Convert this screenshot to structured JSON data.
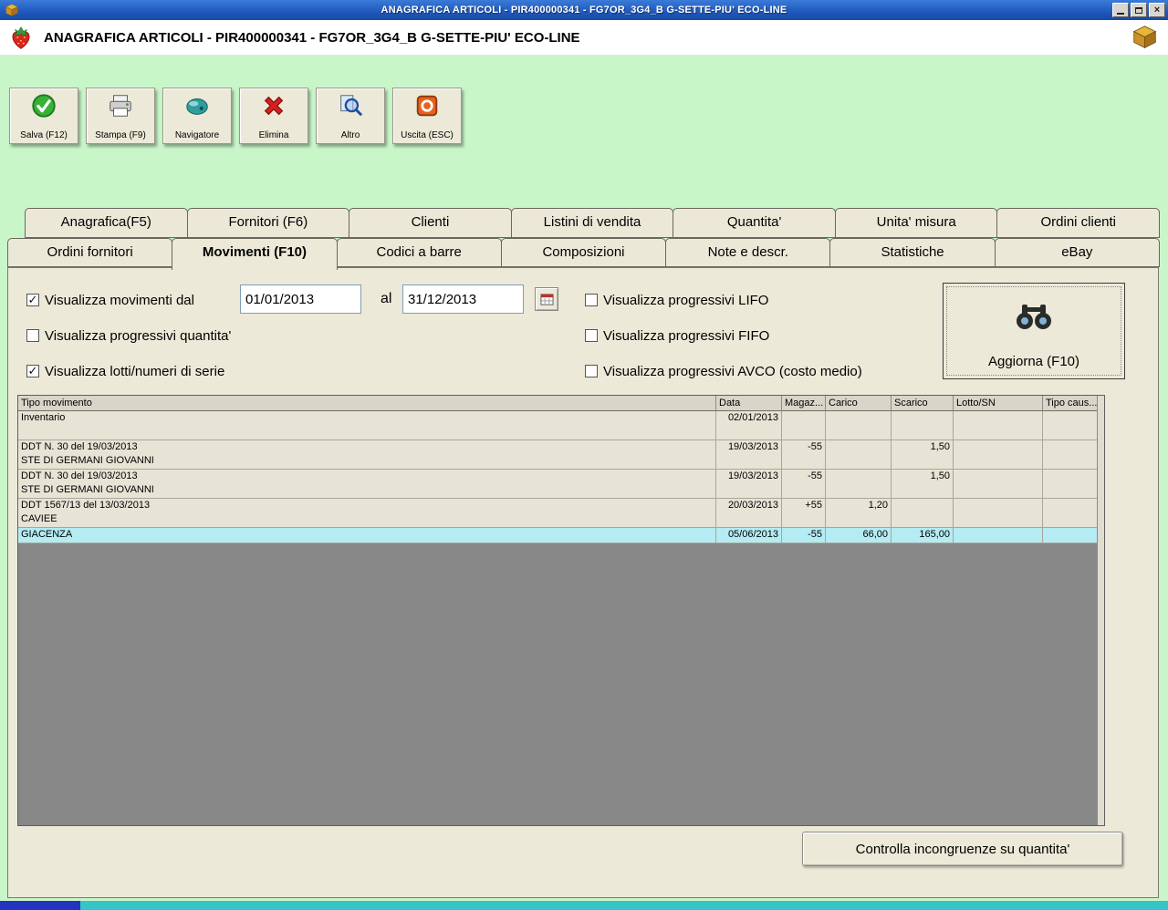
{
  "colors": {
    "background_green": "#c9f6c9",
    "panel": "#ece9d8",
    "highlight_row": "#b5ebf2",
    "titlebar_blue": "#1f58bc",
    "grid_empty_area": "#878787",
    "taskbar_teal": "#35c4c8"
  },
  "icons": {
    "app": "strawberry-icon",
    "package": "box-icon",
    "save": "green-check-circle-icon",
    "print": "printer-icon",
    "navigator": "mouse-icon",
    "delete": "red-x-icon",
    "other": "magnifier-icon",
    "exit": "power-icon",
    "refresh": "binoculars-icon",
    "calendar": "calendar-icon"
  },
  "titlebar": {
    "title": "ANAGRAFICA ARTICOLI - PIR400000341 - FG7OR_3G4_B G-SETTE-PIU' ECO-LINE"
  },
  "header": {
    "title": "ANAGRAFICA ARTICOLI - PIR400000341 - FG7OR_3G4_B G-SETTE-PIU' ECO-LINE"
  },
  "toolbar": {
    "salva": "Salva (F12)",
    "stampa": "Stampa (F9)",
    "navigatore": "Navigatore",
    "elimina": "Elimina",
    "altro": "Altro",
    "uscita": "Uscita (ESC)"
  },
  "tabs": {
    "row1": [
      "Anagrafica(F5)",
      "Fornitori (F6)",
      "Clienti",
      "Listini di vendita",
      "Quantita'",
      "Unita' misura",
      "Ordini clienti"
    ],
    "row2": [
      "Ordini fornitori",
      "Movimenti (F10)",
      "Codici a barre",
      "Composizioni",
      "Note e descr.",
      "Statistiche",
      "eBay"
    ],
    "active": "Movimenti (F10)"
  },
  "filters": {
    "movimenti_label": "Visualizza movimenti dal",
    "movimenti_checked": true,
    "date_from": "01/01/2013",
    "al": "al",
    "date_to": "31/12/2013",
    "quantita_label": "Visualizza progressivi quantita'",
    "quantita_checked": false,
    "lotti_label": "Visualizza lotti/numeri di serie",
    "lotti_checked": true,
    "lifo_label": "Visualizza progressivi LIFO",
    "lifo_checked": false,
    "fifo_label": "Visualizza progressivi FIFO",
    "fifo_checked": false,
    "avco_label": "Visualizza progressivi AVCO (costo medio)",
    "avco_checked": false,
    "aggiorna_label": "Aggiorna (F10)"
  },
  "grid": {
    "columns": [
      "Tipo movimento",
      "Data",
      "Magaz...",
      "Carico",
      "Scarico",
      "Lotto/SN",
      "Tipo caus..."
    ],
    "rows": [
      {
        "line1": "Inventario",
        "line2": "",
        "data": "02/01/2013",
        "magaz": "",
        "carico": "",
        "scarico": "",
        "lotto": "",
        "caus": ""
      },
      {
        "line1": "DDT N. 30 del 19/03/2013",
        "line2": "STE DI GERMANI GIOVANNI",
        "data": "19/03/2013",
        "magaz": "-55",
        "carico": "",
        "scarico": "1,50",
        "lotto": "",
        "caus": ""
      },
      {
        "line1": "DDT N. 30 del 19/03/2013",
        "line2": "STE DI GERMANI GIOVANNI",
        "data": "19/03/2013",
        "magaz": "-55",
        "carico": "",
        "scarico": "1,50",
        "lotto": "",
        "caus": ""
      },
      {
        "line1": "DDT 1567/13 del 13/03/2013",
        "line2": "CAVIEE",
        "data": "20/03/2013",
        "magaz": "+55",
        "carico": "1,20",
        "scarico": "",
        "lotto": "",
        "caus": ""
      },
      {
        "line1": "GIACENZA",
        "line2": "",
        "data": "05/06/2013",
        "magaz": "-55",
        "carico": "66,00",
        "scarico": "165,00",
        "lotto": "",
        "caus": ""
      }
    ]
  },
  "footer": {
    "controlla_label": "Controlla incongruenze su quantita'"
  }
}
